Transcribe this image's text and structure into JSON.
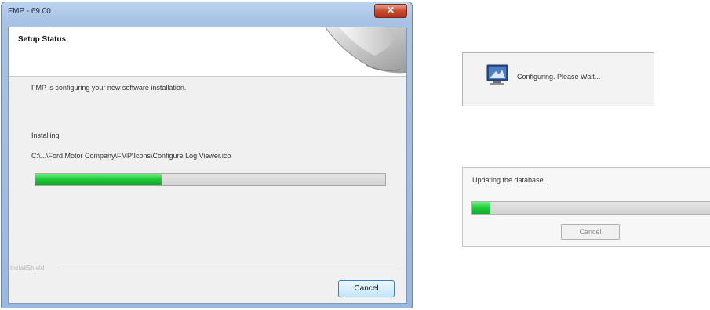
{
  "installer": {
    "title": "FMP - 69.00",
    "close_label": "✕",
    "header_title": "Setup Status",
    "description": "FMP is configuring your new software installation.",
    "status_label": "Installing",
    "file_path": "C:\\...\\Ford Motor Company\\FMP\\Icons\\Configure Log Viewer.ico",
    "progress": 0.36,
    "brand": "InstallShield",
    "cancel_label": "Cancel",
    "header_art_icon": "curl-page-icon"
  },
  "configuring_popup": {
    "icon": "installer-monitor-icon",
    "message": "Configuring. Please Wait..."
  },
  "database_panel": {
    "message": "Updating the database...",
    "progress": 0.08,
    "cancel_label": "Cancel"
  },
  "colors": {
    "progress_green": "#1fc83a",
    "title_close_red": "#c94a2e",
    "window_frame_blue": "#a7c2e4"
  }
}
